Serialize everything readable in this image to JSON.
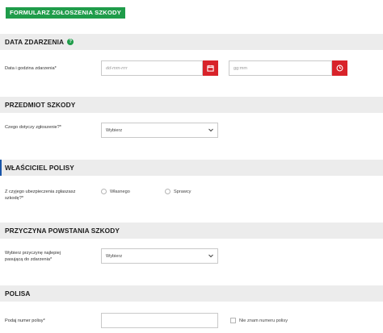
{
  "form_title": "FORMULARZ ZGŁOSZENIA SZKODY",
  "sections": {
    "event_date": {
      "title": "DATA ZDARZENIA",
      "help_icon": "help-icon",
      "label": "Data i godzina zdarzenia*",
      "date_placeholder": "dd-mm-rrrr",
      "time_placeholder": "gg:mm",
      "calendar_icon": "calendar-icon",
      "clock_icon": "clock-icon"
    },
    "damage_subject": {
      "title": "PRZEDMIOT SZKODY",
      "label": "Czego dotyczy zgłoszenie?*",
      "select_value": "Wybierz"
    },
    "policy_owner": {
      "title": "WŁAŚCICIEL POLISY",
      "label_line1": "Z czyjego ubezpieczenia zgłaszasz",
      "label_line2": "szkodę?*",
      "option_own": "Własnego",
      "option_perpetrator": "Sprawcy"
    },
    "damage_cause": {
      "title": "PRZYCZYNA POWSTANIA SZKODY",
      "label_line1": "Wybierz przyczynę najlepiej",
      "label_line2": "pasującą do zdarzenia*",
      "select_value": "Wybierz"
    },
    "policy": {
      "title": "POLISA",
      "label": "Podaj numer polisy*",
      "input_value": "",
      "checkbox_label": "Nie znam numeru polisy"
    }
  },
  "colors": {
    "brand_green": "#1f9c4a",
    "action_red": "#d8232a",
    "section_bg": "#ececec"
  }
}
